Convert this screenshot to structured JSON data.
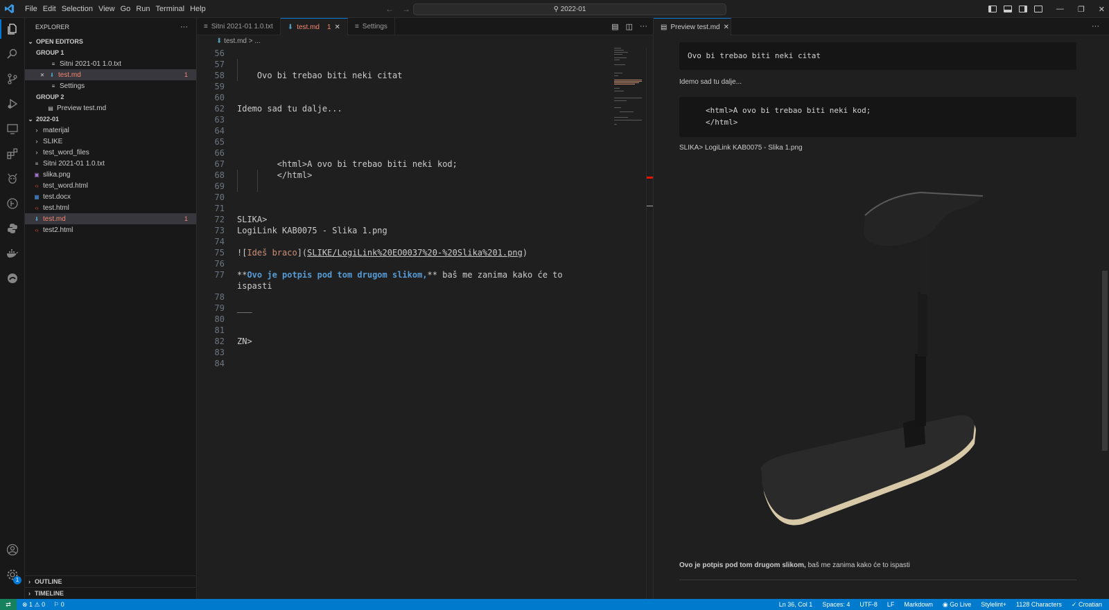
{
  "menu": [
    "File",
    "Edit",
    "Selection",
    "View",
    "Go",
    "Run",
    "Terminal",
    "Help"
  ],
  "command_center": "2022-01",
  "sidebar": {
    "title": "EXPLORER",
    "more": "···",
    "open_editors": "OPEN EDITORS",
    "group1": "GROUP 1",
    "group1_items": [
      "Sitni 2021-01 1.0.txt",
      "test.md",
      "Settings"
    ],
    "group1_count": "1",
    "group2": "GROUP 2",
    "group2_items": [
      "Preview test.md"
    ],
    "folder": "2022-01",
    "folders": [
      "materijal",
      "SLIKE",
      "test_word_files"
    ],
    "files": [
      "Sitni 2021-01 1.0.txt",
      "slika.png",
      "test_word.html",
      "test.docx",
      "test.html",
      "test.md",
      "test2.html"
    ],
    "file_count": "1",
    "outline": "OUTLINE",
    "timeline": "TIMELINE"
  },
  "tabs": [
    {
      "label": "Sitni 2021-01 1.0.txt"
    },
    {
      "label": "test.md",
      "count": "1"
    },
    {
      "label": "Settings"
    }
  ],
  "breadcrumb": "test.md  >  ...",
  "editor": {
    "lines": [
      {
        "n": "56",
        "t": ""
      },
      {
        "n": "57",
        "t": ""
      },
      {
        "n": "58",
        "t": "    Ovo bi trebao biti neki citat"
      },
      {
        "n": "59",
        "t": ""
      },
      {
        "n": "60",
        "t": ""
      },
      {
        "n": "62",
        "t": "Idemo sad tu dalje..."
      },
      {
        "n": "63",
        "t": ""
      },
      {
        "n": "64",
        "t": ""
      },
      {
        "n": "65",
        "t": ""
      },
      {
        "n": "66",
        "t": ""
      },
      {
        "n": "67",
        "t": "        <html>A ovo bi trebao biti neki kod;"
      },
      {
        "n": "68",
        "t": "        </html>"
      },
      {
        "n": "69",
        "t": ""
      },
      {
        "n": "70",
        "t": ""
      },
      {
        "n": "71",
        "t": ""
      },
      {
        "n": "72",
        "t": "SLIKA>"
      },
      {
        "n": "73",
        "t": "LogiLink KAB0075 - Slika 1.png"
      },
      {
        "n": "74",
        "t": ""
      },
      {
        "n": "75",
        "t": ""
      },
      {
        "n": "76",
        "t": ""
      },
      {
        "n": "77",
        "t": ""
      },
      {
        "n": "78",
        "t": ""
      },
      {
        "n": "79",
        "t": "___"
      },
      {
        "n": "80",
        "t": ""
      },
      {
        "n": "81",
        "t": ""
      },
      {
        "n": "82",
        "t": "ZN>"
      },
      {
        "n": "83",
        "t": ""
      },
      {
        "n": "84",
        "t": ""
      }
    ],
    "img_line": {
      "p1": "![",
      "alt": "Ideš braco",
      "p2": "](",
      "url": "SLIKE/LogiLink%20EO0037%20-%20Slika%201.png",
      "p3": ")"
    },
    "bold_line": {
      "s1": "**",
      "b": "Ovo je potpis pod tom drugom slikom,",
      "s2": "**",
      "rest": " baš me zanima kako će to",
      "wrap": "ispasti"
    }
  },
  "preview": {
    "tab": "Preview test.md",
    "quote": "Ovo bi trebao biti neki citat",
    "para1": "Idemo sad tu dalje...",
    "code1": "<html>A ovo bi trebao biti neki kod;",
    "code2": "</html>",
    "caption": "SLIKA> LogiLink KAB0075 - Slika 1.png",
    "bold": "Ovo je potpis pod tom drugom slikom,",
    "rest": " baš me zanima kako će to ispasti"
  },
  "status": {
    "problems": "⊗ 1 ⚠ 0",
    "ports": "⚐ 0",
    "position": "Ln 36, Col 1",
    "spaces": "Spaces: 4",
    "encoding": "UTF-8",
    "eol": "LF",
    "lang": "Markdown",
    "golive": "Go Live",
    "stylelint": "Stylelint+",
    "chars": "1128 Characters",
    "locale": "Croatian"
  },
  "activity_badge": "1",
  "colors": {
    "accent": "#0078d4",
    "status": "#007acc",
    "modified": "#f48771"
  }
}
